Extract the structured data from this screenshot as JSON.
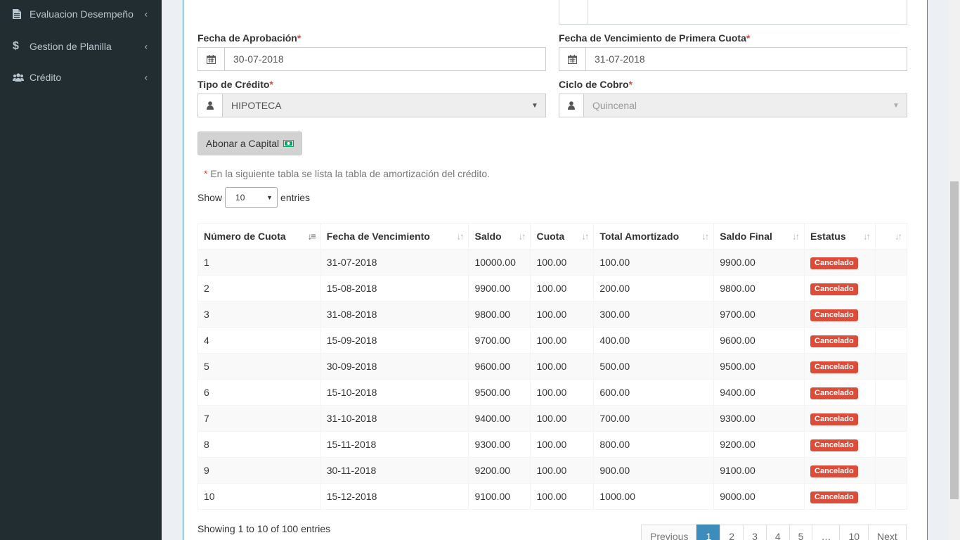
{
  "sidebar": {
    "items": [
      {
        "label": "Evaluacion Desempeño",
        "icon": "file-icon"
      },
      {
        "label": "Gestion de Planilla",
        "icon": "dollar-icon"
      },
      {
        "label": "Crédito",
        "icon": "users-icon"
      }
    ]
  },
  "form": {
    "fecha_aprobacion": {
      "label": "Fecha de Aprobación",
      "value": "30-07-2018"
    },
    "fecha_vencimiento": {
      "label": "Fecha de Vencimiento de Primera Cuota",
      "value": "31-07-2018"
    },
    "tipo_credito": {
      "label": "Tipo de Crédito",
      "value": "HIPOTECA"
    },
    "ciclo_cobro": {
      "label": "Ciclo de Cobro",
      "value": "Quincenal"
    },
    "required_mark": "*"
  },
  "abonar_button": "Abonar a Capital",
  "note": {
    "mark": "*",
    "text": "En la siguiente tabla se lista la tabla de amortización del crédito."
  },
  "length_menu": {
    "show": "Show",
    "value": "10",
    "entries": "entries"
  },
  "table": {
    "headers": [
      "Número de Cuota",
      "Fecha de Vencimiento",
      "Saldo",
      "Cuota",
      "Total Amortizado",
      "Saldo Final",
      "Estatus",
      ""
    ],
    "rows": [
      [
        "1",
        "31-07-2018",
        "10000.00",
        "100.00",
        "100.00",
        "9900.00",
        "Cancelado"
      ],
      [
        "2",
        "15-08-2018",
        "9900.00",
        "100.00",
        "200.00",
        "9800.00",
        "Cancelado"
      ],
      [
        "3",
        "31-08-2018",
        "9800.00",
        "100.00",
        "300.00",
        "9700.00",
        "Cancelado"
      ],
      [
        "4",
        "15-09-2018",
        "9700.00",
        "100.00",
        "400.00",
        "9600.00",
        "Cancelado"
      ],
      [
        "5",
        "30-09-2018",
        "9600.00",
        "100.00",
        "500.00",
        "9500.00",
        "Cancelado"
      ],
      [
        "6",
        "15-10-2018",
        "9500.00",
        "100.00",
        "600.00",
        "9400.00",
        "Cancelado"
      ],
      [
        "7",
        "31-10-2018",
        "9400.00",
        "100.00",
        "700.00",
        "9300.00",
        "Cancelado"
      ],
      [
        "8",
        "15-11-2018",
        "9300.00",
        "100.00",
        "800.00",
        "9200.00",
        "Cancelado"
      ],
      [
        "9",
        "30-11-2018",
        "9200.00",
        "100.00",
        "900.00",
        "9100.00",
        "Cancelado"
      ],
      [
        "10",
        "15-12-2018",
        "9100.00",
        "100.00",
        "1000.00",
        "9000.00",
        "Cancelado"
      ]
    ]
  },
  "info": "Showing 1 to 10 of 100 entries",
  "pagination": [
    "Previous",
    "1",
    "2",
    "3",
    "4",
    "5",
    "…",
    "10",
    "Next"
  ],
  "colors": {
    "accent": "#3c8dbc",
    "danger": "#dd4b39",
    "sidebar": "#222d32"
  }
}
